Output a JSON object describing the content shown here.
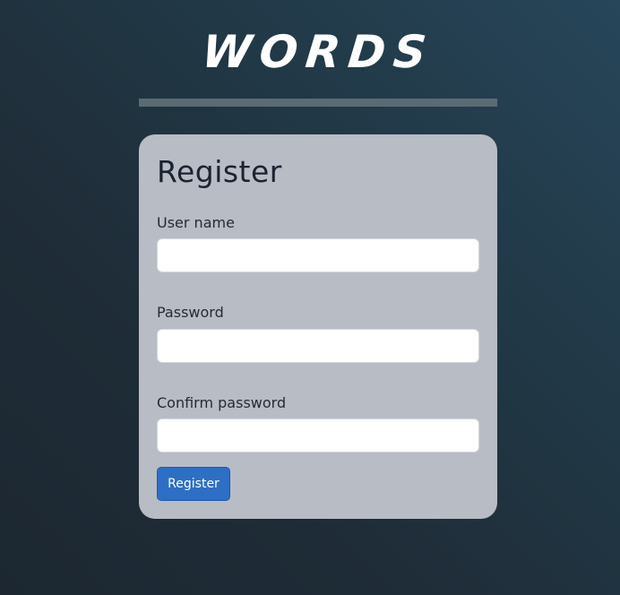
{
  "app": {
    "logo_text": "WORDS"
  },
  "register_form": {
    "title": "Register",
    "fields": [
      {
        "label": "User name",
        "value": "",
        "placeholder": ""
      },
      {
        "label": "Password",
        "value": "",
        "placeholder": ""
      },
      {
        "label": "Confirm password",
        "value": "",
        "placeholder": ""
      }
    ],
    "submit_label": "Register"
  },
  "colors": {
    "background_dark": "#1c2731",
    "background_light": "#27465a",
    "divider": "#5b6b74",
    "card": "#b8bcc5",
    "button": "#2d6fc4",
    "logo": "#ffffff"
  }
}
